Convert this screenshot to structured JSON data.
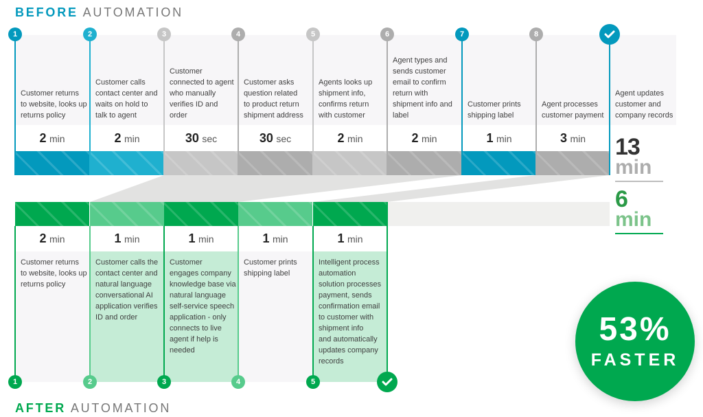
{
  "colors": {
    "teal_dark": "#0399bd",
    "teal_light": "#1fb0cf",
    "gray_light": "#c6c6c6",
    "gray_dark": "#adadad",
    "green_dark": "#00a84f",
    "green_light": "#57cb8c",
    "green_card": "#c5ecd6",
    "gray_card": "#f7f6f8",
    "title_gray": "#777777",
    "total_before_num": "#333333",
    "total_before_unit": "#adadad",
    "total_after_num": "#2b9a47",
    "total_after_unit": "#7cc38a"
  },
  "before": {
    "title_strong": "BEFORE",
    "title_rest": "AUTOMATION",
    "steps": [
      {
        "marker": "1",
        "text": "Customer returns\nto website, looks up\nreturns policy",
        "value": "2",
        "unit": "min"
      },
      {
        "marker": "2",
        "text": "Customer calls\ncontact center and\nwaits on hold to\ntalk to agent",
        "value": "2",
        "unit": "min"
      },
      {
        "marker": "3",
        "text": "Customer\nconnected to agent\nwho manually\nverifies ID and\norder",
        "value": "30",
        "unit": "sec"
      },
      {
        "marker": "4",
        "text": "Customer asks\nquestion related\nto product return\nshipment address",
        "value": "30",
        "unit": "sec"
      },
      {
        "marker": "5",
        "text": "Agents looks up\nshipment info,\nconfirms return\nwith customer",
        "value": "2",
        "unit": "min"
      },
      {
        "marker": "6",
        "text": "Agent types and\nsends customer\nemail to confirm\nreturn with\nshipment info and\nlabel",
        "value": "2",
        "unit": "min"
      },
      {
        "marker": "7",
        "text": "Customer prints\nshipping label",
        "value": "1",
        "unit": "min"
      },
      {
        "marker": "8",
        "text": "Agent processes\ncustomer payment",
        "value": "3",
        "unit": "min"
      }
    ],
    "final_step": {
      "marker_icon": "check-icon",
      "text": "Agent updates\ncustomer and\ncompany records"
    },
    "total": {
      "value": "13",
      "unit": "min"
    }
  },
  "after": {
    "title_strong": "AFTER",
    "title_rest": "AUTOMATION",
    "steps": [
      {
        "marker": "1",
        "text": "Customer returns\nto website, looks up\nreturns policy",
        "value": "2",
        "unit": "min"
      },
      {
        "marker": "2",
        "text": "Customer calls the\ncontact center and\nnatural language\nconversational AI\napplication verifies\nID and order",
        "value": "1",
        "unit": "min"
      },
      {
        "marker": "3",
        "text": "Customer\nengages company\nknowledge base via\nnatural language\nself-service speech\napplication - only\nconnects to live\nagent if help is\nneeded",
        "value": "1",
        "unit": "min"
      },
      {
        "marker": "4",
        "text": "Customer prints\nshipping label",
        "value": "1",
        "unit": "min"
      },
      {
        "marker": "5",
        "text": "Intelligent process\nautomation\nsolution processes\npayment, sends\nconfirmation email\nto customer with\nshipment info\nand automatically\nupdates company\nrecords",
        "value": "1",
        "unit": "min"
      }
    ],
    "final_marker_icon": "check-icon",
    "total": {
      "value": "6",
      "unit": "min"
    }
  },
  "badge": {
    "value": "53%",
    "label": "FASTER"
  }
}
